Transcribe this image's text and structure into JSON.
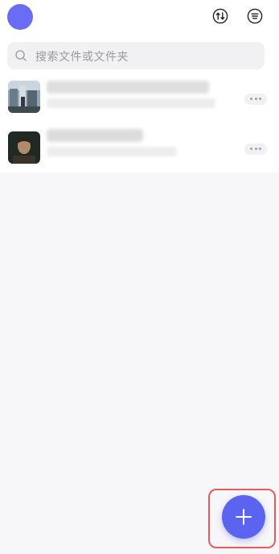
{
  "colors": {
    "background": "#f7f7f9",
    "accent": "#5b63f0",
    "avatar": "#6b6cf6",
    "highlight_border": "#e45c5c"
  },
  "header": {
    "avatar_icon": "user-avatar",
    "sort_icon": "sort-arrows-icon",
    "menu_icon": "list-menu-icon"
  },
  "search": {
    "placeholder": "搜索文件或文件夹",
    "icon": "search-icon"
  },
  "files": [
    {
      "thumbnail": "street-scene-image",
      "name_blurred": true,
      "more_icon": "ellipsis-icon"
    },
    {
      "thumbnail": "portrait-image",
      "name_blurred": true,
      "more_icon": "ellipsis-icon"
    }
  ],
  "fab": {
    "icon": "plus-icon"
  }
}
